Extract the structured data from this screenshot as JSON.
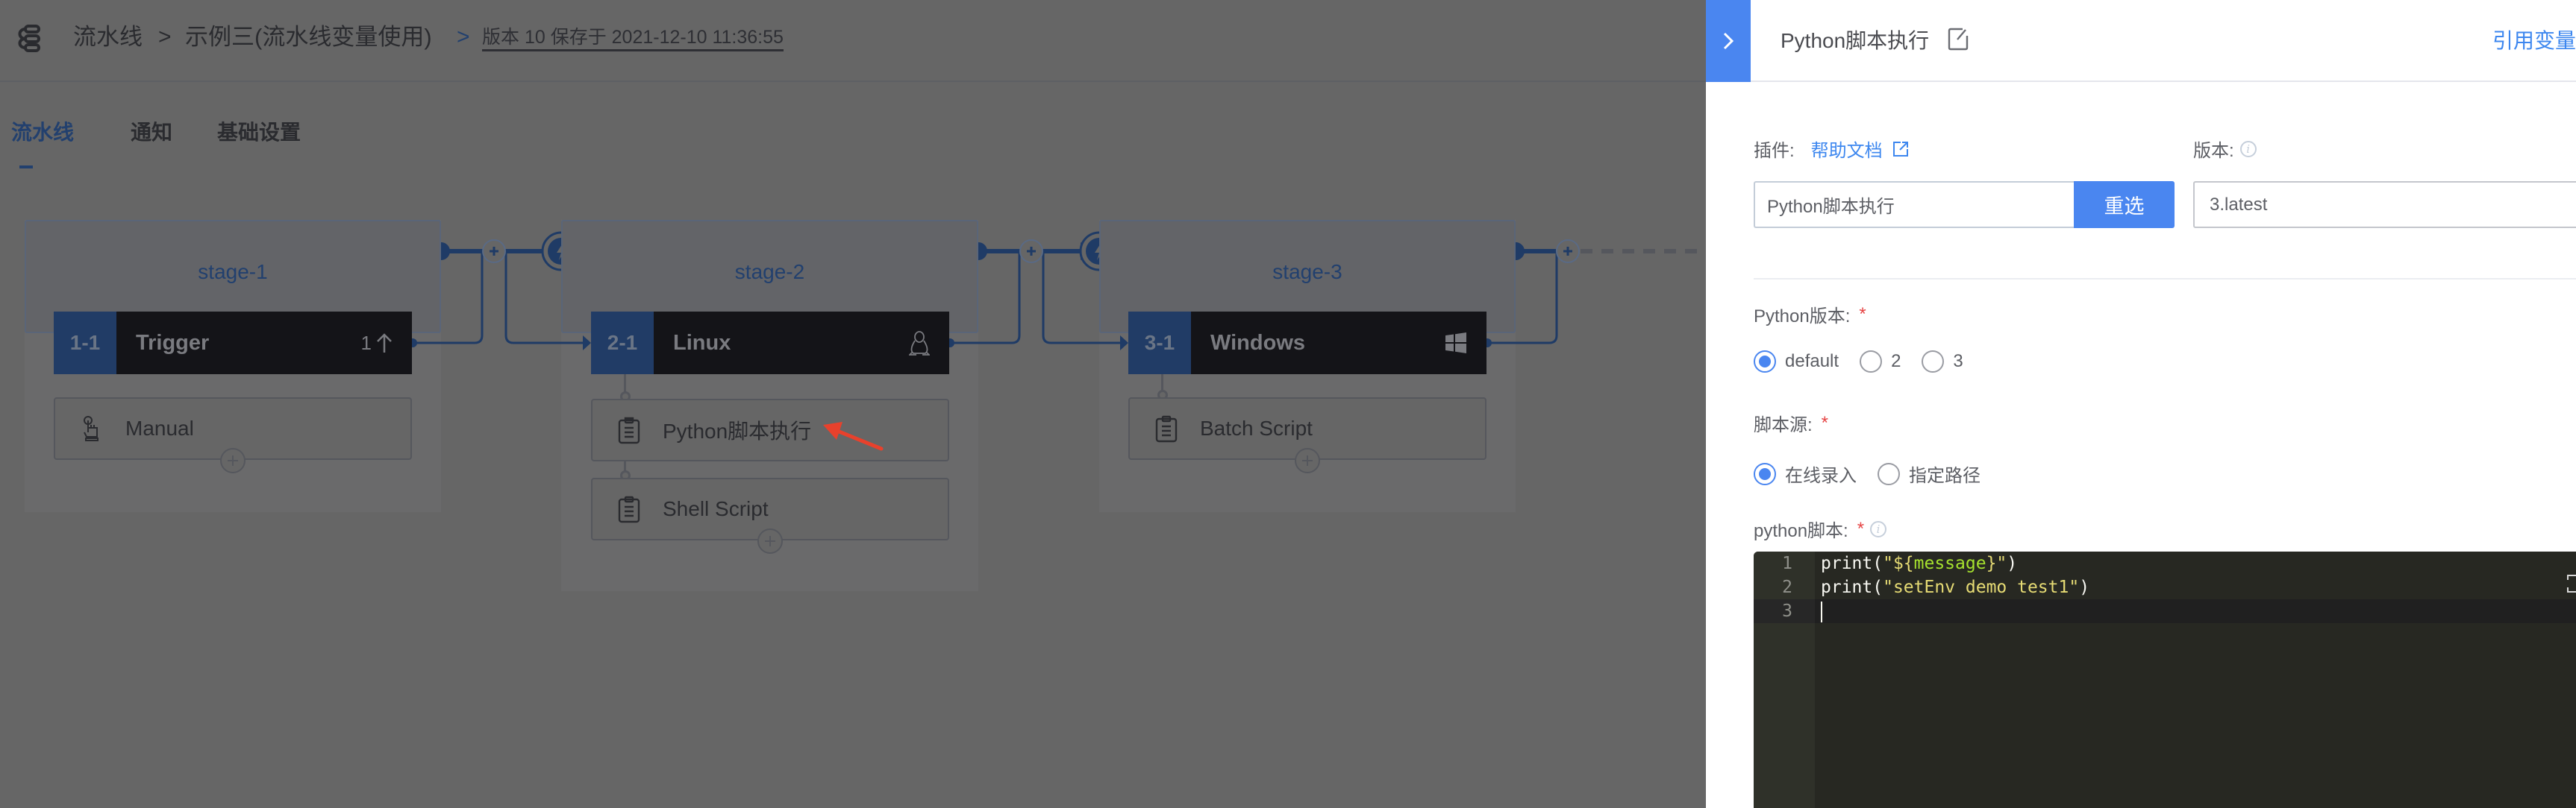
{
  "header": {
    "root_label": "流水线",
    "pipeline_name": "示例三(流水线变量使用)",
    "version_info": "版本 10 保存于 2021-12-10 11:36:55",
    "separator": ">"
  },
  "tabs": [
    {
      "label": "流水线",
      "active": true
    },
    {
      "label": "通知",
      "active": false
    },
    {
      "label": "基础设置",
      "active": false
    }
  ],
  "stages": [
    {
      "name": "stage-1",
      "job": {
        "index": "1-1",
        "name": "Trigger",
        "right_text": "1",
        "right_icon": "arrow-up-icon"
      },
      "tasks": [
        {
          "name": "Manual",
          "icon": "hand-pointer-icon"
        }
      ]
    },
    {
      "name": "stage-2",
      "job": {
        "index": "2-1",
        "name": "Linux",
        "right_icon": "linux-icon"
      },
      "tasks": [
        {
          "name": "Python脚本执行",
          "icon": "clipboard-icon",
          "highlighted": true
        },
        {
          "name": "Shell Script",
          "icon": "clipboard-icon"
        }
      ]
    },
    {
      "name": "stage-3",
      "job": {
        "index": "3-1",
        "name": "Windows",
        "right_icon": "windows-icon"
      },
      "tasks": [
        {
          "name": "Batch Script",
          "icon": "clipboard-icon"
        }
      ]
    }
  ],
  "panel": {
    "title": "Python脚本执行",
    "reference_vars_label": "引用变量",
    "plugin": {
      "label": "插件:",
      "help_label": "帮助文档",
      "value": "Python脚本执行",
      "reselect_label": "重选"
    },
    "version": {
      "label": "版本:",
      "value": "3.latest"
    },
    "python_version": {
      "label": "Python版本:",
      "required": "*",
      "options": [
        "default",
        "2",
        "3"
      ],
      "selected": "default"
    },
    "script_source": {
      "label": "脚本源:",
      "required": "*",
      "options": [
        "在线录入",
        "指定路径"
      ],
      "selected": "在线录入"
    },
    "python_script": {
      "label": "python脚本:",
      "required": "*",
      "lines": [
        {
          "no": "1",
          "text": "print(\"${message}\")"
        },
        {
          "no": "2",
          "text": "print(\"setEnv demo test1\")"
        },
        {
          "no": "3",
          "text": ""
        }
      ]
    }
  },
  "colors": {
    "accent": "#4a86f0",
    "link": "#3d87ef",
    "required": "#e64545",
    "overlay": "#666666",
    "annotation_arrow": "#e8412c"
  }
}
